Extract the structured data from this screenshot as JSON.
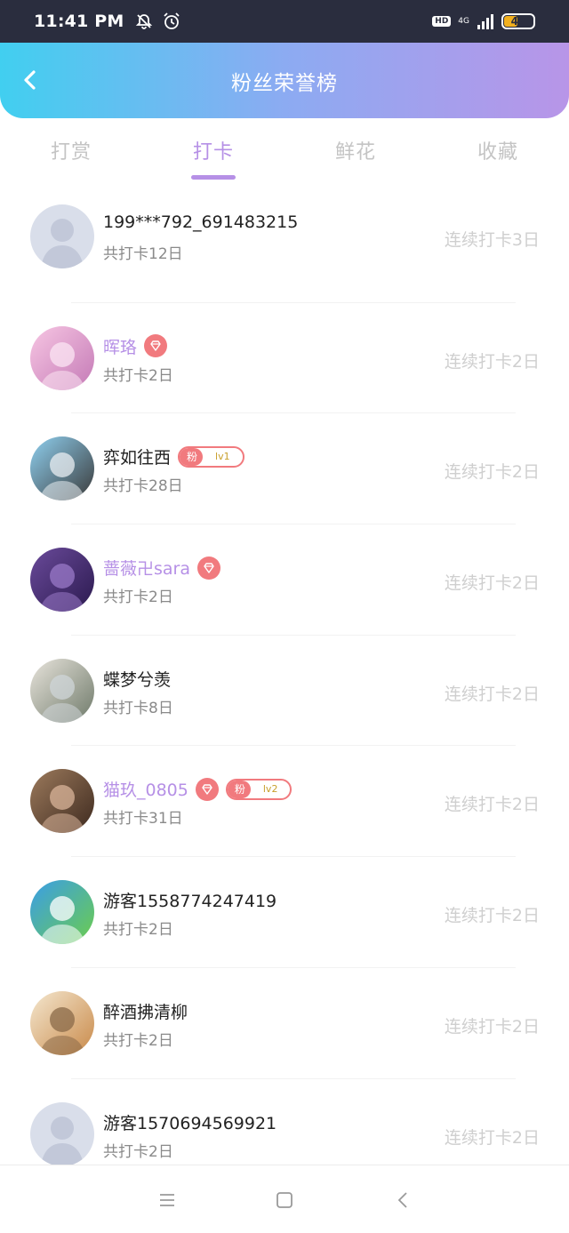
{
  "status_bar": {
    "time": "11:41 PM",
    "hd": "HD",
    "network": "4G",
    "battery": "47",
    "battery_level": 0.47,
    "icons": [
      "bell-off-icon",
      "alarm-icon",
      "signal-icon"
    ]
  },
  "header": {
    "title": "粉丝荣誉榜",
    "back_icon": "chevron-left-icon",
    "gradient": [
      "#41cff0",
      "#b895e8"
    ]
  },
  "tabs": [
    {
      "label": "打赏",
      "active": false
    },
    {
      "label": "打卡",
      "active": true
    },
    {
      "label": "鲜花",
      "active": false
    },
    {
      "label": "收藏",
      "active": false
    }
  ],
  "accent_color": "#b690e6",
  "users": [
    {
      "name": "199***792_691483215",
      "total": "共打卡12日",
      "streak": "连续打卡3日",
      "vip": false,
      "diamond": false,
      "fan_badge": null,
      "avatar": "default"
    },
    {
      "name": "晖珞",
      "total": "共打卡2日",
      "streak": "连续打卡2日",
      "vip": true,
      "diamond": true,
      "fan_badge": null,
      "avatar": "anime-pink"
    },
    {
      "name": "弈如往西",
      "total": "共打卡28日",
      "streak": "连续打卡2日",
      "vip": false,
      "diamond": false,
      "fan_badge": {
        "char": "粉",
        "level": "lv1"
      },
      "avatar": "anime-white"
    },
    {
      "name": "蔷薇卍sara",
      "total": "共打卡2日",
      "streak": "连续打卡2日",
      "vip": true,
      "diamond": true,
      "fan_badge": null,
      "avatar": "purple-night"
    },
    {
      "name": "蝶梦兮羡",
      "total": "共打卡8日",
      "streak": "连续打卡2日",
      "vip": false,
      "diamond": false,
      "fan_badge": null,
      "avatar": "flowers"
    },
    {
      "name": "猫玖_0805",
      "total": "共打卡31日",
      "streak": "连续打卡2日",
      "vip": true,
      "diamond": true,
      "fan_badge": {
        "char": "粉",
        "level": "lv2"
      },
      "avatar": "photo-girl"
    },
    {
      "name": "游客1558774247419",
      "total": "共打卡2日",
      "streak": "连续打卡2日",
      "vip": false,
      "diamond": false,
      "fan_badge": null,
      "avatar": "sky-heart"
    },
    {
      "name": "醉酒拂清柳",
      "total": "共打卡2日",
      "streak": "连续打卡2日",
      "vip": false,
      "diamond": false,
      "fan_badge": null,
      "avatar": "anime-hat"
    },
    {
      "name": "游客1570694569921",
      "total": "共打卡2日",
      "streak": "连续打卡2日",
      "vip": false,
      "diamond": false,
      "fan_badge": null,
      "avatar": "default"
    }
  ],
  "nav": {
    "icons": [
      "menu-icon",
      "home-square-icon",
      "back-triangle-icon"
    ]
  }
}
